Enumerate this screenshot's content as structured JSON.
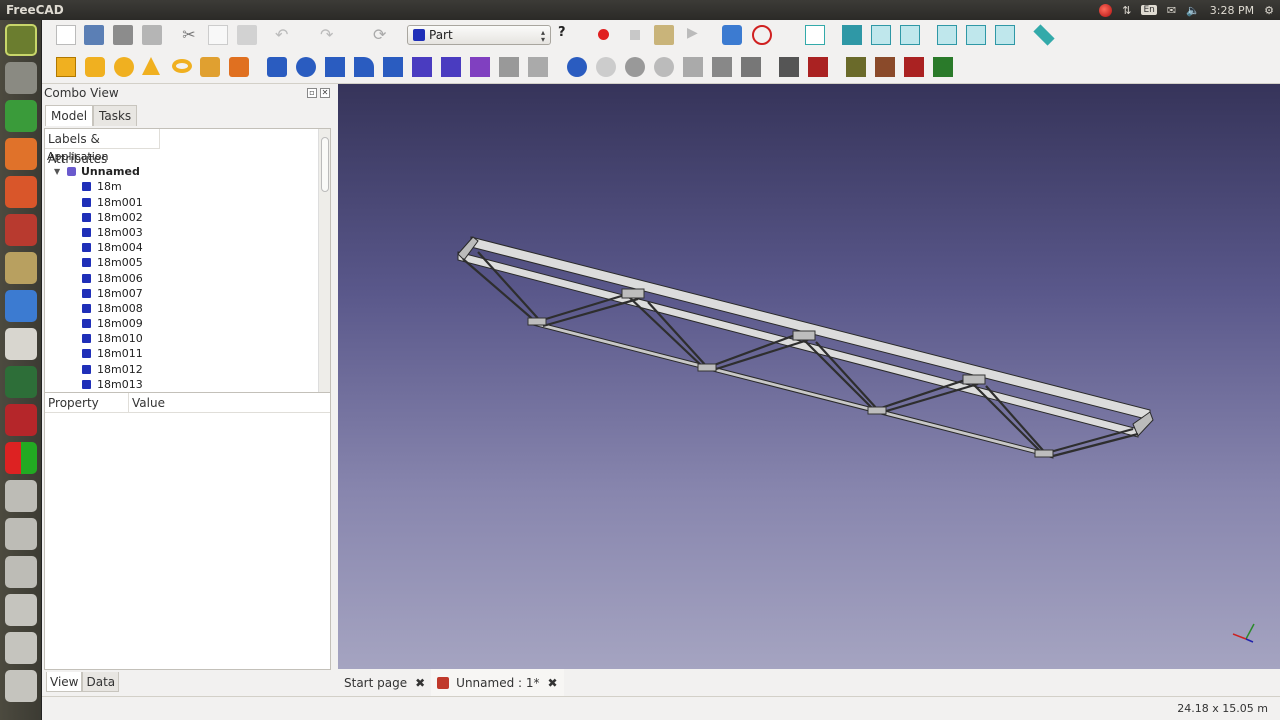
{
  "topbar": {
    "app_title": "FreeCAD",
    "lang": "En",
    "time": "3:28 PM"
  },
  "workbench": {
    "selected": "Part"
  },
  "combo": {
    "title": "Combo View",
    "tabs": [
      "Model",
      "Tasks"
    ],
    "tree_header": "Labels & Attributes",
    "app_label": "Application",
    "doc_label": "Unnamed",
    "objects": [
      "18m",
      "18m001",
      "18m002",
      "18m003",
      "18m004",
      "18m005",
      "18m006",
      "18m007",
      "18m008",
      "18m009",
      "18m010",
      "18m011",
      "18m012",
      "18m013"
    ],
    "prop_headers": [
      "Property",
      "Value"
    ],
    "view_tabs": [
      "View",
      "Data"
    ]
  },
  "doc_tabs": [
    "Start page",
    "Unnamed : 1*"
  ],
  "status": {
    "dimensions": "24.18 x 15.05 m"
  },
  "colors": {
    "accent_part": "#1f2fb8",
    "view_top": "#36345a",
    "view_bottom": "#a5a4c1"
  }
}
